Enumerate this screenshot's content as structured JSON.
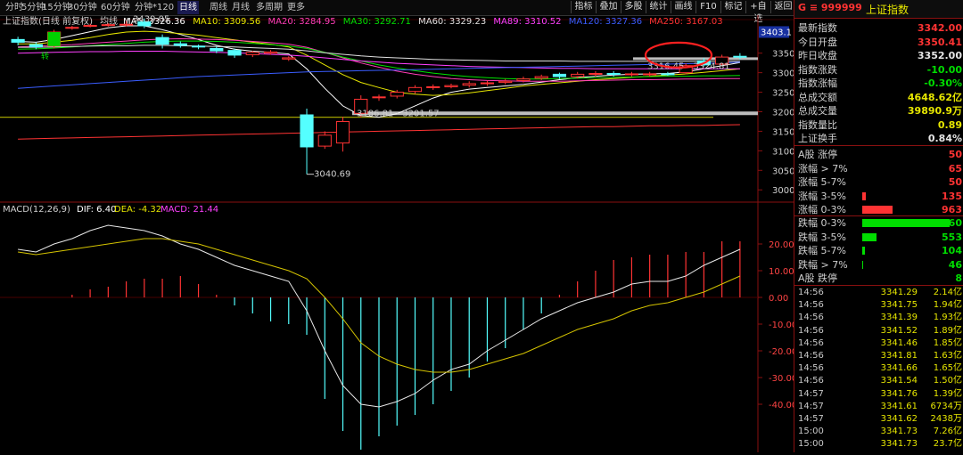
{
  "toolbar": {
    "periods": [
      "分时",
      "5分钟",
      "15分钟",
      "30分钟",
      "60分钟",
      "分钟*120",
      "日线",
      "周线",
      "月线",
      "多周期",
      "更多"
    ],
    "active_period": "日线",
    "right_buttons": [
      "指标",
      "叠加",
      "多股",
      "统计",
      "画线",
      "F10",
      "标记",
      "+自选",
      "返回"
    ]
  },
  "ma_bar": {
    "title": "上证指数(日线 前复权)",
    "label": "均线",
    "items": [
      {
        "name": "MA5",
        "value": "3326.36",
        "color": "#ffffff"
      },
      {
        "name": "MA10",
        "value": "3309.56",
        "color": "#e6e600"
      },
      {
        "name": "MA20",
        "value": "3284.95",
        "color": "#ff3db8"
      },
      {
        "name": "MA30",
        "value": "3292.71",
        "color": "#00e000"
      },
      {
        "name": "MA60",
        "value": "3329.23",
        "color": "#e0e0e0"
      },
      {
        "name": "MA89",
        "value": "3310.52",
        "color": "#ff40ff"
      },
      {
        "name": "MA120",
        "value": "3327.36",
        "color": "#3a5dff"
      },
      {
        "name": "MA250",
        "value": "3167.03",
        "color": "#ff3333"
      }
    ]
  },
  "macd_bar": {
    "label": "MACD(12,26,9)",
    "dif": "DIF: 6.40",
    "dea": "DEA: -4.32",
    "macd": "MACD: 21.44"
  },
  "annotations": {
    "high": "3439.05",
    "low": "3040.69",
    "range1": "3186.81 - 3201.57",
    "range2": "3316.45 - 3324.81",
    "price_tag": "3403.1",
    "mark": "转"
  },
  "chart_data": {
    "type": "candlestick",
    "price_axis": {
      "ticks": [
        "3350",
        "3300",
        "3250",
        "3200",
        "3150",
        "3100",
        "3050",
        "3000"
      ],
      "range": [
        2980,
        3420
      ]
    },
    "macd_axis": {
      "ticks": [
        "20.00",
        "10.00",
        "0.00",
        "-10.00",
        "-20.00",
        "-30.00",
        "-40.00"
      ],
      "range": [
        -58,
        30
      ]
    },
    "candles": [
      {
        "o": 3385,
        "c": 3378,
        "h": 3392,
        "l": 3370
      },
      {
        "o": 3372,
        "c": 3366,
        "h": 3378,
        "l": 3360
      },
      {
        "o": 3368,
        "c": 3404,
        "h": 3410,
        "l": 3362
      },
      {
        "o": 3414,
        "c": 3416,
        "h": 3420,
        "l": 3410
      },
      {
        "o": 3420,
        "c": 3421,
        "h": 3425,
        "l": 3416
      },
      {
        "o": 3421,
        "c": 3423,
        "h": 3427,
        "l": 3418
      },
      {
        "o": 3422,
        "c": 3424,
        "h": 3432,
        "l": 3418
      },
      {
        "o": 3430,
        "c": 3420,
        "h": 3439,
        "l": 3414
      },
      {
        "o": 3390,
        "c": 3373,
        "h": 3398,
        "l": 3362
      },
      {
        "o": 3374,
        "c": 3370,
        "h": 3380,
        "l": 3364
      },
      {
        "o": 3368,
        "c": 3366,
        "h": 3372,
        "l": 3360
      },
      {
        "o": 3362,
        "c": 3356,
        "h": 3368,
        "l": 3350
      },
      {
        "o": 3357,
        "c": 3345,
        "h": 3362,
        "l": 3338
      },
      {
        "o": 3346,
        "c": 3352,
        "h": 3356,
        "l": 3340
      },
      {
        "o": 3350,
        "c": 3353,
        "h": 3358,
        "l": 3346
      },
      {
        "o": 3335,
        "c": 3338,
        "h": 3342,
        "l": 3330
      },
      {
        "o": 3192,
        "c": 3110,
        "h": 3208,
        "l": 3040
      },
      {
        "o": 3112,
        "c": 3140,
        "h": 3150,
        "l": 3105
      },
      {
        "o": 3120,
        "c": 3175,
        "h": 3187,
        "l": 3098
      },
      {
        "o": 3196,
        "c": 3232,
        "h": 3242,
        "l": 3186
      },
      {
        "o": 3236,
        "c": 3238,
        "h": 3244,
        "l": 3228
      },
      {
        "o": 3240,
        "c": 3250,
        "h": 3256,
        "l": 3234
      },
      {
        "o": 3252,
        "c": 3262,
        "h": 3268,
        "l": 3246
      },
      {
        "o": 3262,
        "c": 3264,
        "h": 3270,
        "l": 3256
      },
      {
        "o": 3264,
        "c": 3267,
        "h": 3272,
        "l": 3260
      },
      {
        "o": 3268,
        "c": 3272,
        "h": 3278,
        "l": 3262
      },
      {
        "o": 3272,
        "c": 3274,
        "h": 3280,
        "l": 3266
      },
      {
        "o": 3275,
        "c": 3278,
        "h": 3284,
        "l": 3270
      },
      {
        "o": 3280,
        "c": 3284,
        "h": 3290,
        "l": 3275
      },
      {
        "o": 3286,
        "c": 3290,
        "h": 3295,
        "l": 3281
      },
      {
        "o": 3296,
        "c": 3290,
        "h": 3300,
        "l": 3284
      },
      {
        "o": 3290,
        "c": 3296,
        "h": 3302,
        "l": 3285
      },
      {
        "o": 3297,
        "c": 3298,
        "h": 3304,
        "l": 3290
      },
      {
        "o": 3298,
        "c": 3296,
        "h": 3304,
        "l": 3290
      },
      {
        "o": 3296,
        "c": 3297,
        "h": 3302,
        "l": 3290
      },
      {
        "o": 3296,
        "c": 3297,
        "h": 3302,
        "l": 3290
      },
      {
        "o": 3297,
        "c": 3296,
        "h": 3302,
        "l": 3292
      },
      {
        "o": 3300,
        "c": 3318,
        "h": 3324,
        "l": 3296
      },
      {
        "o": 3330,
        "c": 3320,
        "h": 3338,
        "l": 3316
      },
      {
        "o": 3322,
        "c": 3340,
        "h": 3346,
        "l": 3318
      },
      {
        "o": 3342,
        "c": 3341,
        "h": 3350,
        "l": 3334
      }
    ],
    "ma_lines": [
      {
        "name": "MA5",
        "color": "#ffffff",
        "values": [
          3380,
          3378,
          3385,
          3395,
          3405,
          3415,
          3420,
          3420,
          3410,
          3398,
          3385,
          3370,
          3360,
          3355,
          3352,
          3348,
          3310,
          3260,
          3215,
          3190,
          3186,
          3195,
          3215,
          3235,
          3250,
          3258,
          3262,
          3266,
          3270,
          3276,
          3282,
          3287,
          3291,
          3294,
          3296,
          3297,
          3298,
          3302,
          3310,
          3318,
          3326
        ]
      },
      {
        "name": "MA10",
        "color": "#e6e600",
        "values": [
          3374,
          3374,
          3378,
          3383,
          3390,
          3398,
          3404,
          3406,
          3404,
          3400,
          3396,
          3390,
          3384,
          3378,
          3373,
          3366,
          3345,
          3320,
          3295,
          3275,
          3262,
          3250,
          3245,
          3242,
          3244,
          3248,
          3254,
          3260,
          3266,
          3270,
          3274,
          3278,
          3282,
          3285,
          3288,
          3291,
          3294,
          3297,
          3301,
          3305,
          3310
        ]
      },
      {
        "name": "MA20",
        "color": "#ff3db8",
        "values": [
          3366,
          3368,
          3370,
          3372,
          3375,
          3378,
          3381,
          3384,
          3386,
          3387,
          3386,
          3385,
          3383,
          3380,
          3377,
          3373,
          3365,
          3352,
          3338,
          3325,
          3314,
          3304,
          3296,
          3290,
          3285,
          3282,
          3280,
          3279,
          3278,
          3278,
          3278,
          3279,
          3280,
          3281,
          3282,
          3282,
          3283,
          3284,
          3284,
          3285,
          3285
        ]
      },
      {
        "name": "MA30",
        "color": "#00e000",
        "values": [
          3360,
          3361,
          3363,
          3366,
          3369,
          3372,
          3375,
          3378,
          3380,
          3381,
          3381,
          3380,
          3378,
          3375,
          3372,
          3368,
          3362,
          3352,
          3340,
          3330,
          3320,
          3312,
          3305,
          3299,
          3294,
          3290,
          3287,
          3285,
          3284,
          3284,
          3285,
          3286,
          3287,
          3288,
          3289,
          3290,
          3291,
          3291,
          3292,
          3292,
          3293
        ]
      },
      {
        "name": "MA60",
        "color": "#e0e0e0",
        "values": [
          3365,
          3365,
          3366,
          3367,
          3368,
          3369,
          3369,
          3370,
          3370,
          3369,
          3368,
          3367,
          3366,
          3364,
          3362,
          3360,
          3356,
          3351,
          3347,
          3343,
          3340,
          3338,
          3336,
          3334,
          3333,
          3332,
          3331,
          3330,
          3330,
          3330,
          3330,
          3329,
          3329,
          3329,
          3329,
          3329,
          3329,
          3329,
          3329,
          3329,
          3329
        ]
      },
      {
        "name": "MA89",
        "color": "#ff40ff",
        "values": [
          3350,
          3351,
          3352,
          3353,
          3354,
          3354,
          3355,
          3355,
          3355,
          3354,
          3353,
          3352,
          3351,
          3349,
          3347,
          3345,
          3342,
          3338,
          3334,
          3330,
          3327,
          3324,
          3322,
          3320,
          3318,
          3316,
          3315,
          3314,
          3313,
          3312,
          3311,
          3311,
          3310,
          3310,
          3310,
          3310,
          3310,
          3310,
          3310,
          3310,
          3310
        ]
      },
      {
        "name": "MA120",
        "color": "#3a5dff",
        "values": [
          3260,
          3263,
          3266,
          3269,
          3272,
          3275,
          3278,
          3281,
          3284,
          3287,
          3290,
          3292,
          3294,
          3296,
          3298,
          3300,
          3302,
          3303,
          3304,
          3305,
          3306,
          3307,
          3308,
          3309,
          3310,
          3311,
          3312,
          3313,
          3314,
          3315,
          3316,
          3317,
          3318,
          3319,
          3320,
          3321,
          3322,
          3323,
          3324,
          3325,
          3327
        ]
      },
      {
        "name": "MA250",
        "color": "#ff3333",
        "values": [
          3130,
          3131,
          3132,
          3133,
          3134,
          3135,
          3136,
          3137,
          3138,
          3139,
          3140,
          3141,
          3142,
          3143,
          3144,
          3145,
          3146,
          3147,
          3148,
          3149,
          3150,
          3151,
          3152,
          3153,
          3154,
          3155,
          3156,
          3157,
          3158,
          3159,
          3160,
          3161,
          3162,
          3162,
          3163,
          3164,
          3164,
          3165,
          3165,
          3166,
          3167
        ]
      }
    ],
    "macd_hist": [
      0,
      0,
      0,
      1,
      3,
      4,
      6,
      7,
      7,
      8,
      5,
      1,
      -3,
      -6,
      -9,
      -10,
      -14,
      -38,
      -50,
      -57,
      -52,
      -48,
      -44,
      -40,
      -35,
      -30,
      -24,
      -19,
      -12,
      -6,
      1,
      6,
      10,
      14,
      15,
      16,
      16,
      17,
      17,
      21,
      21
    ],
    "dif": [
      18,
      17,
      20,
      22,
      25,
      27,
      26,
      25,
      23,
      20,
      18,
      15,
      12,
      10,
      8,
      6,
      -5,
      -20,
      -33,
      -40,
      -41,
      -39,
      -36,
      -31,
      -27,
      -25,
      -20,
      -16,
      -12,
      -8,
      -5,
      -2,
      0,
      2,
      5,
      6,
      6,
      8,
      12,
      15,
      18
    ],
    "dea": [
      17,
      16,
      17,
      18,
      19,
      20,
      21,
      22,
      22,
      21,
      20,
      18,
      16,
      14,
      12,
      10,
      7,
      0,
      -8,
      -17,
      -22,
      -25,
      -27,
      -28,
      -28,
      -27,
      -25,
      -23,
      -21,
      -18,
      -15,
      -12,
      -10,
      -8,
      -5,
      -3,
      -2,
      0,
      2,
      5,
      8
    ]
  },
  "panel": {
    "code_label": "G ≡ 999999",
    "name": "上证指数",
    "stats": [
      {
        "label": "最新指数",
        "value": "3342.00",
        "color": "#ff3333"
      },
      {
        "label": "今日开盘",
        "value": "3350.41",
        "color": "#ff3333"
      },
      {
        "label": "昨日收盘",
        "value": "3352.00",
        "color": "#e6e6e6"
      },
      {
        "label": "指数涨跌",
        "value": "-10.00",
        "color": "#00dd00"
      },
      {
        "label": "指数涨幅",
        "value": "-0.30%",
        "color": "#00dd00"
      },
      {
        "label": "总成交额",
        "value": "4648.62亿",
        "color": "#e6e600"
      },
      {
        "label": "总成交量",
        "value": "39890.9万",
        "color": "#e6e600"
      },
      {
        "label": "指数量比",
        "value": "0.89",
        "color": "#e6e600"
      },
      {
        "label": "上证换手",
        "value": "0.84%",
        "color": "#e6e6e6"
      }
    ],
    "up": [
      {
        "label": "A股 涨停",
        "value": "50",
        "bar": 0
      },
      {
        "label": "涨幅 > 7%",
        "value": "65",
        "bar": 0
      },
      {
        "label": "涨幅 5-7%",
        "value": "50",
        "bar": 0
      },
      {
        "label": "涨幅 3-5%",
        "value": "135",
        "bar": 4
      },
      {
        "label": "涨幅 0-3%",
        "value": "963",
        "bar": 34
      }
    ],
    "down": [
      {
        "label": "跌幅 0-3%",
        "value": "3360",
        "bar": 98
      },
      {
        "label": "跌幅 3-5%",
        "value": "553",
        "bar": 16
      },
      {
        "label": "跌幅 5-7%",
        "value": "104",
        "bar": 3
      },
      {
        "label": "跌幅 > 7%",
        "value": "46",
        "bar": 1
      },
      {
        "label": "A股 跌停",
        "value": "8",
        "bar": 0
      }
    ],
    "ticks": [
      {
        "time": "14:56",
        "price": "3341.29",
        "vol": "2.14亿"
      },
      {
        "time": "14:56",
        "price": "3341.75",
        "vol": "1.94亿"
      },
      {
        "time": "14:56",
        "price": "3341.39",
        "vol": "1.93亿"
      },
      {
        "time": "14:56",
        "price": "3341.52",
        "vol": "1.89亿"
      },
      {
        "time": "14:56",
        "price": "3341.46",
        "vol": "1.85亿"
      },
      {
        "time": "14:56",
        "price": "3341.81",
        "vol": "1.63亿"
      },
      {
        "time": "14:56",
        "price": "3341.66",
        "vol": "1.65亿"
      },
      {
        "time": "14:56",
        "price": "3341.54",
        "vol": "1.50亿"
      },
      {
        "time": "14:57",
        "price": "3341.76",
        "vol": "1.39亿"
      },
      {
        "time": "14:57",
        "price": "3341.61",
        "vol": "6734万"
      },
      {
        "time": "14:57",
        "price": "3341.62",
        "vol": "2438万"
      },
      {
        "time": "15:00",
        "price": "3341.73",
        "vol": "7.26亿"
      },
      {
        "time": "15:00",
        "price": "3341.73",
        "vol": "23.7亿"
      }
    ]
  }
}
